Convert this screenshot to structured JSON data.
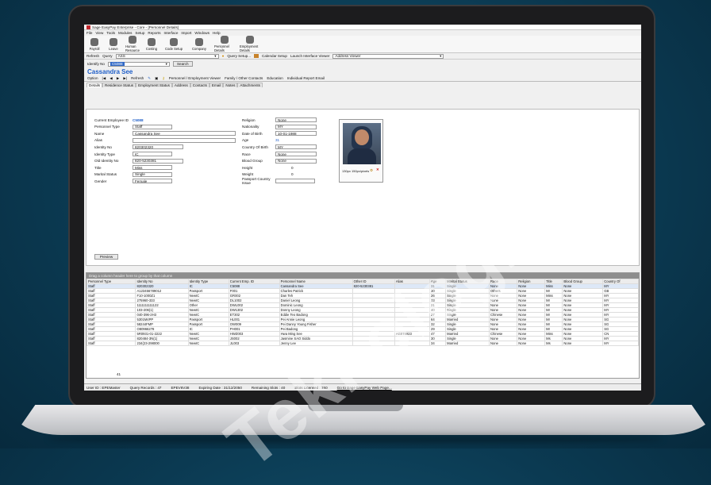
{
  "window": {
    "title": "Sage EasyPay Enterprise - Core - [Personnel Details]"
  },
  "menu": [
    "File",
    "View",
    "Tools",
    "Modules",
    "Setup",
    "Reports",
    "Interface",
    "Import",
    "Windows",
    "Help"
  ],
  "toolbar": [
    {
      "label": "Payroll",
      "icon": "payroll-icon"
    },
    {
      "label": "Leave",
      "icon": "leave-icon"
    },
    {
      "label": "Human Resource",
      "icon": "hr-icon"
    },
    {
      "label": "Costing",
      "icon": "costing-icon"
    },
    {
      "label": "Code Setup",
      "icon": "code-setup-icon"
    },
    {
      "label": "Company",
      "icon": "company-icon"
    },
    {
      "label": "Personnel Details",
      "icon": "personnel-icon"
    },
    {
      "label": "Employment Details",
      "icon": "employment-icon"
    }
  ],
  "refresh": {
    "label": "Refresh",
    "query_label": "Query",
    "query_value": "ASS",
    "query_setup": "Query Setup...",
    "calendar_setup": "Calendar Setup",
    "launch_label": "Launch Interface Viewer",
    "launch_value": "Address Viewer"
  },
  "identify": {
    "label": "Identify No",
    "value": "C5088",
    "search": "Search"
  },
  "employee_name": "Cassandra See",
  "nav": {
    "option": "Option",
    "refresh": "Refresh",
    "links": [
      "Personnel / Employment Viewer",
      "Family / Other Contacts",
      "Education",
      "Individual Report Email"
    ]
  },
  "tabs": [
    "Details",
    "Residence Status",
    "Employment Status",
    "Address",
    "Contacts",
    "Email",
    "Notes",
    "Attachments"
  ],
  "form_left": [
    {
      "label": "Current Employee ID",
      "value": "C5088"
    },
    {
      "label": "Personnel Type",
      "value": "Staff"
    },
    {
      "label": "Name",
      "value": "Cassandra See"
    },
    {
      "label": "Alias",
      "value": ""
    },
    {
      "label": "Identity No",
      "value": "820302320"
    },
    {
      "label": "Identity Type",
      "value": "IC"
    },
    {
      "label": "Old Identity No",
      "value": "820-5230381"
    },
    {
      "label": "Title",
      "value": "Miss"
    },
    {
      "label": "Marital Status",
      "value": "Single"
    },
    {
      "label": "Gender",
      "value": "Female"
    }
  ],
  "form_right": [
    {
      "label": "Religion",
      "value": "None"
    },
    {
      "label": "Nationality",
      "value": "MY"
    },
    {
      "label": "Date of Birth",
      "value": "10-01-1988"
    },
    {
      "label": "Age",
      "value": "31"
    },
    {
      "label": "Country Of Birth",
      "value": "MY"
    },
    {
      "label": "Race",
      "value": "None"
    },
    {
      "label": "Blood Group",
      "value": "None"
    },
    {
      "label": "Height",
      "value": "0"
    },
    {
      "label": "Weight",
      "value": "0"
    },
    {
      "label": "Passport Country Issue",
      "value": ""
    }
  ],
  "photo_caption": "130px 150px/pixels",
  "preview_button": "Preview",
  "grid": {
    "group_hint": "Drag a column header here to group by that column",
    "headers": [
      "Personnel Type",
      "Identity No",
      "Identity Type",
      "Current Emp. ID",
      "Personnel Name",
      "Other ID",
      "Alias",
      "Age",
      "Marital Status",
      "Race",
      "Religion",
      "Title",
      "Blood Group",
      "Country Of"
    ],
    "rows": [
      [
        "Staff",
        "820302320",
        "IC",
        "C5088",
        "Cassandra See",
        "820-5230381",
        "",
        "31",
        "Single",
        "None",
        "None",
        "Miss",
        "None",
        "MY"
      ],
      [
        "Staff",
        "A123456789012",
        "Passport",
        "F001",
        "Charles Patrick",
        "",
        "",
        "30",
        "Single",
        "Others",
        "None",
        "Mr",
        "None",
        "GB"
      ],
      [
        "Staff",
        "F10-1000Z1",
        "NewIC",
        "GR002",
        "Dan Teh",
        "",
        "",
        "26",
        "Single",
        "None",
        "None",
        "Miss",
        "None",
        "MY"
      ],
      [
        "Staff",
        "275960-333",
        "NewIC",
        "DL1002",
        "Daniel Leong",
        "",
        "",
        "33",
        "Single",
        "None",
        "None",
        "Mr",
        "None",
        "MY"
      ],
      [
        "Staff",
        "1111111111122",
        "Other",
        "DWL002",
        "Dominic Leong",
        "",
        "",
        "21",
        "Single",
        "None",
        "None",
        "Mr",
        "None",
        "MY"
      ],
      [
        "Staff",
        "103-206(1)",
        "NewIC",
        "DW1302",
        "Donny Leong",
        "",
        "",
        "40",
        "Single",
        "None",
        "None",
        "Mr",
        "None",
        "MY"
      ],
      [
        "Staff",
        "040-396-2H3",
        "NewIC",
        "ET302",
        "Eddie Teo Badong",
        "",
        "",
        "27",
        "Single",
        "Chinese",
        "None",
        "Mr",
        "None",
        "MY"
      ],
      [
        "Staff",
        "5301M4PP",
        "Passport",
        "HL001",
        "Pei Annie Leong",
        "",
        "",
        "64",
        "Married",
        "None",
        "None",
        "Mr",
        "None",
        "SG"
      ],
      [
        "Staff",
        "58244FMP",
        "Passport",
        "OW009",
        "Pei Danny Young Fisher",
        "",
        "",
        "32",
        "Single",
        "None",
        "None",
        "Mr",
        "None",
        "SG"
      ],
      [
        "Staff",
        "O80966278",
        "IC",
        "PH001",
        "Pei Badong",
        "",
        "",
        "29",
        "Single",
        "None",
        "None",
        "Mr",
        "None",
        "SG"
      ],
      [
        "Staff",
        "5R0931-01-2222",
        "NewIC",
        "HWZ003",
        "Hwa Ming See",
        "",
        "AG074923",
        "47",
        "Married",
        "Chinese",
        "None",
        "Miss",
        "None",
        "CN"
      ],
      [
        "Staff",
        "820484-3N(1)",
        "NewIC",
        "JS002",
        "Jasmine SAO Siddo",
        "",
        "",
        "30",
        "Single",
        "None",
        "None",
        "Ms",
        "None",
        "MY"
      ],
      [
        "Staff",
        "234(23-298000",
        "NewIC",
        "JL003",
        "Jenny Lee",
        "",
        "",
        "34",
        "Married",
        "None",
        "None",
        "Ms",
        "None",
        "MY"
      ]
    ],
    "footer_count": "41"
  },
  "status": {
    "user": "User ID : EPEMaster",
    "records": "Query Records : 47",
    "db": "EPEV6V38",
    "expiry": "Expiring Date : 31/12/2050",
    "remaining": "Remaining Slots : 40",
    "licensed": "Slots Licensed : 150",
    "link": "Go to Sage EasyPay Web Page..."
  },
  "watermark": "Teknologi.co"
}
